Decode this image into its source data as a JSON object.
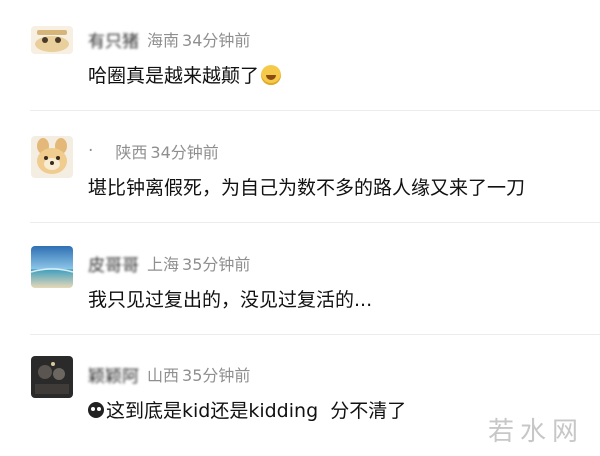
{
  "comments": [
    {
      "username": "有只猪",
      "location": "海南",
      "time": "34分钟前",
      "text": "哈圈真是越来越颠了",
      "avatar_icon": "cartoon-sticker-avatar-icon",
      "trailing_emoji": "laughing-tears-emoji-icon"
    },
    {
      "username": "·",
      "location": "陕西",
      "time": "34分钟前",
      "text": "堪比钟离假死，为自己为数不多的路人缘又来了一刀",
      "avatar_icon": "plush-bear-avatar-icon"
    },
    {
      "username": "皮哥哥",
      "location": "上海",
      "time": "35分钟前",
      "text": "我只见过复出的，没见过复活的...",
      "avatar_icon": "ocean-sky-avatar-icon"
    },
    {
      "username": "颖颖阿",
      "location": "山西",
      "time": "35分钟前",
      "text": "这到底是kid还是kidding  分不清了",
      "avatar_icon": "dark-photo-avatar-icon",
      "leading_emoji": "monkey-emoji-icon"
    }
  ],
  "watermark": "若水网",
  "colors": {
    "meta_gray": "#8f8f8f",
    "text_black": "#111111",
    "divider": "#ececec"
  }
}
